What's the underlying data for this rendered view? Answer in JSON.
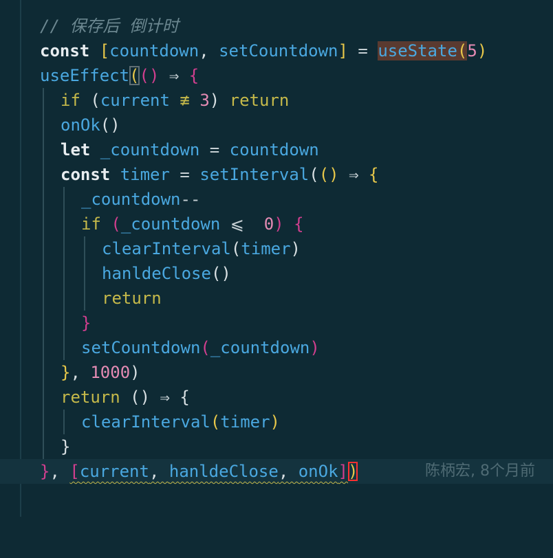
{
  "code": {
    "l1": "// 保存后 倒计时",
    "l2": {
      "kw": "const",
      "sp1": " ",
      "ob": "[",
      "v1": "countdown",
      "comma": ", ",
      "v2": "setCountdown",
      "cb": "]",
      "eq": " = ",
      "fn": "useState",
      "op": "(",
      "n": "5",
      "cp": ")"
    },
    "l3": {
      "fn": "useEffect",
      "op": "(",
      "ap": "()",
      "arrow": " ⇒ ",
      "ob": "{"
    },
    "l4": {
      "ctl": "if",
      "sp": " ",
      "op": "(",
      "v": "current",
      "neq": " ≢ ",
      "n": "3",
      "cp": ")",
      "ret": " return"
    },
    "l5": {
      "fn": "onOk",
      "p": "()"
    },
    "l6": {
      "kw": "let",
      "v1": " _countdown",
      "eq": " = ",
      "v2": "countdown"
    },
    "l7": {
      "kw": "const",
      "v": " timer",
      "eq": " = ",
      "fn": "setInterval",
      "op": "(",
      "ap": "()",
      "arrow": " ⇒ ",
      "ob": "{"
    },
    "l8": {
      "v": "_countdown",
      "op": "--"
    },
    "l9": {
      "ctl": "if",
      "op": " (",
      "v": "_countdown",
      "le": " ⩽ ",
      "n": " 0",
      "cp": ")",
      "ob": " {"
    },
    "l10": {
      "fn": "clearInterval",
      "op": "(",
      "v": "timer",
      "cp": ")"
    },
    "l11": {
      "fn": "hanldeClose",
      "p": "()"
    },
    "l12": {
      "ctl": "return"
    },
    "l13": {
      "cb": "}"
    },
    "l14": {
      "fn": "setCountdown",
      "op": "(",
      "v": "_countdown",
      "cp": ")"
    },
    "l15": {
      "cb": "}",
      "comma": ", ",
      "n": "1000",
      "cp": ")"
    },
    "l16": {
      "ctl": "return",
      "sp": " ",
      "p": "()",
      "arrow": " ⇒ ",
      "ob": "{"
    },
    "l17": {
      "fn": "clearInterval",
      "op": "(",
      "v": "timer",
      "cp": ")"
    },
    "l18": {
      "cb": "}"
    },
    "l19": {
      "cb": "}",
      "comma": ", ",
      "ob": "[",
      "v1": "current",
      "c1": ", ",
      "v2": "hanldeClose",
      "c2": ", ",
      "v3": "onOk",
      "cbk": "]",
      "cp": ")"
    }
  },
  "blame": "陈柄宏, 8个月前"
}
